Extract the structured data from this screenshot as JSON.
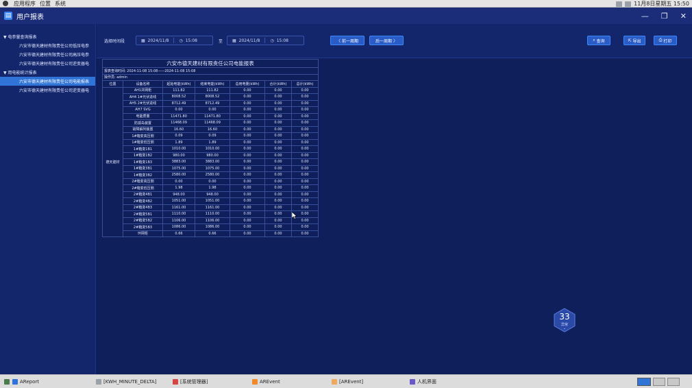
{
  "sysbar": {
    "menu": [
      "应用程序",
      "位置",
      "系统"
    ],
    "clock": "11月8日星期五 15:50"
  },
  "window": {
    "title": "用户报表"
  },
  "sidebar": {
    "groups": [
      {
        "label": "▼ 电参量查询报表",
        "items": [
          {
            "label": "六安市德天建材有限责任公司低压电参",
            "active": false
          },
          {
            "label": "六安市德天建材有限责任公司高压电参",
            "active": false
          },
          {
            "label": "六安市德天建材有限责任公司逆变器电",
            "active": false
          }
        ]
      },
      {
        "label": "▼ 用电能统计报表",
        "items": [
          {
            "label": "六安市德天建材有限责任公司电能报表",
            "active": true
          },
          {
            "label": "六安市德天建材有限责任公司逆变器电",
            "active": false
          }
        ]
      }
    ]
  },
  "toolbar": {
    "select_time_label": "选择时间段",
    "start_date": "2024/11/8",
    "start_time": "15:08",
    "to_label": "至",
    "end_date": "2024/11/8",
    "end_time": "15:08",
    "prev_week": "〈 前一周期",
    "next_week": "后一周期 〉",
    "query": "查询",
    "export": "导出",
    "print": "打印"
  },
  "report": {
    "title": "六安市德天建材有限责任公司电能报表",
    "query_time": "报表查询时间: 2024-11-08 15:08——2024-11-08 15:08",
    "operator": "操作员: admin",
    "headers": [
      "位置",
      "设备名称",
      "起始电能(kWh)",
      "结束电能(kWh)",
      "总用电量(kWh)",
      "合计(kWh)",
      "总计(kWh)"
    ],
    "location": "德天建材",
    "rows": [
      [
        "AH1并网柜",
        "111.82",
        "111.82",
        "0.00",
        "0.00",
        "0.00"
      ],
      [
        "AH4 1#光伏进线",
        "8008.52",
        "8008.52",
        "0.00",
        "0.00",
        "0.00"
      ],
      [
        "AH5 2#光伏进线",
        "8712.49",
        "8712.49",
        "0.00",
        "0.00",
        "0.00"
      ],
      [
        "AH7 SVG",
        "0.00",
        "0.00",
        "0.00",
        "0.00",
        "0.00"
      ],
      [
        "电能质量",
        "11471.80",
        "11471.80",
        "0.00",
        "0.00",
        "0.00"
      ],
      [
        "防孤岛装置",
        "11468.09",
        "11468.09",
        "0.00",
        "0.00",
        "0.00"
      ],
      [
        "故障解列装置",
        "16.60",
        "16.60",
        "0.00",
        "0.00",
        "0.00"
      ],
      [
        "1#箱变高压侧",
        "0.09",
        "0.09",
        "0.00",
        "0.00",
        "0.00"
      ],
      [
        "1#箱变低压侧",
        "1.89",
        "1.89",
        "0.00",
        "0.00",
        "0.00"
      ],
      [
        "1#箱变1B1",
        "1010.00",
        "1010.00",
        "0.00",
        "0.00",
        "0.00"
      ],
      [
        "1#箱变1B2",
        "980.00",
        "980.00",
        "0.00",
        "0.00",
        "0.00"
      ],
      [
        "1#箱变1B3",
        "3883.00",
        "3883.00",
        "0.00",
        "0.00",
        "0.00"
      ],
      [
        "1#箱变3B1",
        "1075.00",
        "1075.00",
        "0.00",
        "0.00",
        "0.00"
      ],
      [
        "1#箱变3B2",
        "2580.00",
        "2580.00",
        "0.00",
        "0.00",
        "0.00"
      ],
      [
        "2#箱变高压侧",
        "0.00",
        "0.00",
        "0.00",
        "0.00",
        "0.00"
      ],
      [
        "2#箱变低压侧",
        "1.98",
        "1.98",
        "0.00",
        "0.00",
        "0.00"
      ],
      [
        "2#箱变4B1",
        "948.00",
        "948.00",
        "0.00",
        "0.00",
        "0.00"
      ],
      [
        "2#箱变4B2",
        "1051.00",
        "1051.00",
        "0.00",
        "0.00",
        "0.00"
      ],
      [
        "2#箱变4B3",
        "1161.00",
        "1161.00",
        "0.00",
        "0.00",
        "0.00"
      ],
      [
        "2#箱变5B1",
        "1110.00",
        "1110.00",
        "0.00",
        "0.00",
        "0.00"
      ],
      [
        "2#箱变5B2",
        "1106.00",
        "1106.00",
        "0.00",
        "0.00",
        "0.00"
      ],
      [
        "2#箱变5B3",
        "1086.00",
        "1086.00",
        "0.00",
        "0.00",
        "0.00"
      ],
      [
        "环网柜",
        "0.66",
        "0.66",
        "0.00",
        "0.00",
        "0.00"
      ]
    ]
  },
  "badge": {
    "count": "33",
    "label": "异常"
  },
  "taskbar": {
    "items": [
      "AReport",
      "[KWH_MINUTE_DELTA]",
      "[系统管理器]",
      "AREvent",
      "[AREvent]",
      "人机界面"
    ]
  },
  "colors": {
    "accent": "#2f74d6",
    "background": "#0f1f5c",
    "panel": "#13266c"
  }
}
